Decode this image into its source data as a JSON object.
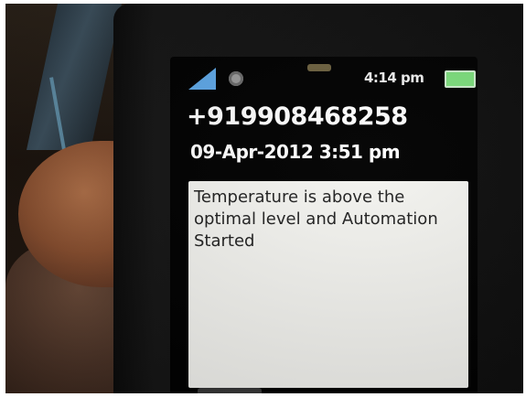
{
  "status_bar": {
    "time": "4:14 pm",
    "icons": [
      "signal-icon",
      "gear-icon",
      "music-icon",
      "battery-icon"
    ]
  },
  "message": {
    "sender": "+919908468258",
    "datetime": "09-Apr-2012 3:51 pm",
    "body": "Temperature is above the optimal level and Automation Started"
  },
  "colors": {
    "screen_bg": "#000000",
    "message_bg": "#f4f4f0",
    "signal": "#5fa8e8",
    "battery": "#7ee07e"
  }
}
